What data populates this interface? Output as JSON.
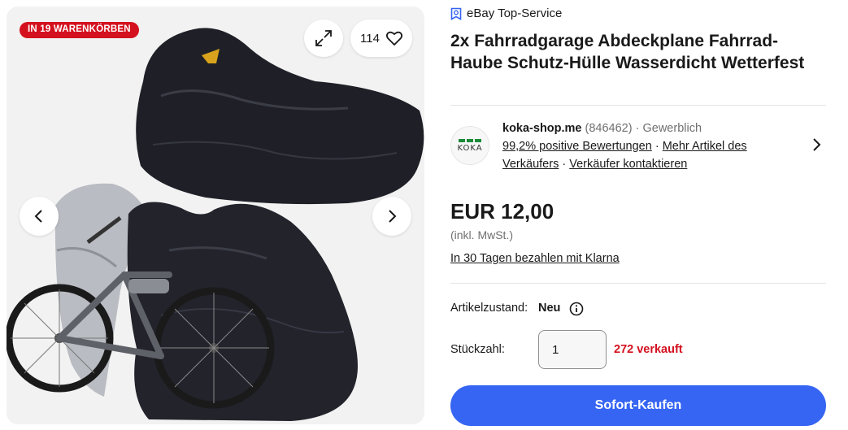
{
  "gallery": {
    "badge": "IN 19 WARENKÖRBEN",
    "watch_count": "114",
    "icons": {
      "expand": "expand-icon",
      "heart": "heart-icon",
      "prev": "chevron-left-icon",
      "next": "chevron-right-icon"
    },
    "photo_alt": "Fahrradgarage Abdeckplane"
  },
  "listing": {
    "top_service": "eBay Top-Service",
    "title": "2x Fahrradgarage Abdeckplane Fahrrad-Haube Schutz-Hülle Wasserdicht Wetterfest"
  },
  "seller": {
    "logo_text": "KOKA",
    "name": "koka-shop.me",
    "count": "(846462)",
    "separator": "·",
    "type": "Gewerblich",
    "rating_link": "99,2% positive Bewertungen",
    "more_link": "Mehr Artikel des Verkäufers",
    "contact_link": "Verkäufer kontaktieren"
  },
  "price": {
    "amount": "EUR 12,00",
    "vat": "(inkl. MwSt.)",
    "klarna": "In 30 Tagen bezahlen mit Klarna"
  },
  "condition": {
    "label": "Artikelzustand:",
    "value": "Neu"
  },
  "quantity": {
    "label": "Stückzahl:",
    "value": "1",
    "sold": "272 verkauft"
  },
  "buy_button": "Sofort-Kaufen",
  "colors": {
    "accent": "#3665f3",
    "badge_red": "#d4111f",
    "logo_green": "#1c8a3a"
  }
}
